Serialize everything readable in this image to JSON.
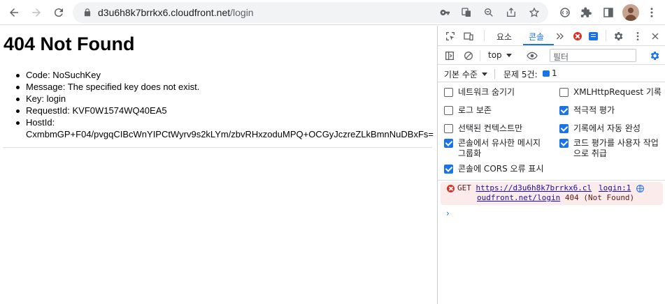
{
  "browser": {
    "url_host": "d3u6h8k7brrkx6.cloudfront.net",
    "url_path": "/login",
    "icons": {
      "back": "back-arrow-icon",
      "forward": "forward-arrow-icon",
      "reload": "reload-icon",
      "lock": "lock-icon"
    }
  },
  "page": {
    "title": "404 Not Found",
    "items": [
      "Code: NoSuchKey",
      "Message: The specified key does not exist.",
      "Key: login",
      "RequestId: KVF0W1574WQ40EA5",
      "HostId:",
      "CxmbmGP+F04/pvgqCIBcWnYIPCtWyrv9s2kLYm/zbvRHxzoduMPQ+OCGyJczreZLkBmnNuDBxFs="
    ]
  },
  "devtools": {
    "tabs": {
      "elements": "요소",
      "console": "콘솔"
    },
    "context": "top",
    "filter_placeholder": "필터",
    "levels_label": "기본 수준",
    "issues_label": "문제 5건:",
    "issues_count": "1",
    "settings": {
      "hide_network": "네트워크 숨기기",
      "xhr_logging": "XMLHttpRequest 기록",
      "preserve_log": "로그 보존",
      "eager_eval": "적극적 평가",
      "selected_context": "선택된 컨텍스트만",
      "autocomplete": "기록에서 자동 완성",
      "group_similar_1": "콘솔에서 유사한 메시지",
      "group_similar_2": "그룹화",
      "user_activation_1": "코드 평가를 사용자 작업",
      "user_activation_2": "으로 취급",
      "cors_errors": "콘솔에 CORS 오류 표시"
    },
    "message": {
      "method": "GET",
      "url_part1": "https://d3u6h8k7brrkx6.cl",
      "url_part2": "oudfront.net/login",
      "status": "404 (Not Found)",
      "source": "login:1"
    },
    "prompt": "›",
    "accent_color": "#1a73e8",
    "error_color": "#d93025"
  }
}
